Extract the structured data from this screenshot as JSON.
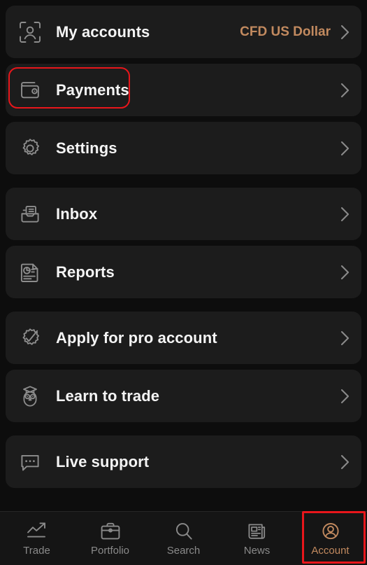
{
  "theme": {
    "page_bg": "#0d0d0d",
    "card_bg": "#1c1c1c",
    "accent": "#c28a5f",
    "highlight": "#e8161b",
    "label_color": "#f4f4f4",
    "icon_color": "#8d8d8d"
  },
  "menu": {
    "groups": [
      {
        "rows": [
          {
            "id": "my-accounts",
            "label": "My accounts",
            "value": "CFD US Dollar",
            "icon": "account-frame-icon",
            "chevron": true
          },
          {
            "id": "payments",
            "label": "Payments",
            "value": "",
            "icon": "wallet-icon",
            "chevron": true,
            "highlighted": true
          },
          {
            "id": "settings",
            "label": "Settings",
            "value": "",
            "icon": "gear-icon",
            "chevron": true
          }
        ]
      },
      {
        "rows": [
          {
            "id": "inbox",
            "label": "Inbox",
            "value": "",
            "icon": "inbox-tray-icon",
            "chevron": true
          },
          {
            "id": "reports",
            "label": "Reports",
            "value": "",
            "icon": "report-document-icon",
            "chevron": true
          }
        ]
      },
      {
        "rows": [
          {
            "id": "apply-pro-account",
            "label": "Apply for pro account",
            "value": "",
            "icon": "badge-check-icon",
            "chevron": true
          },
          {
            "id": "learn-to-trade",
            "label": "Learn to trade",
            "value": "",
            "icon": "owl-graduate-icon",
            "chevron": true
          }
        ]
      },
      {
        "rows": [
          {
            "id": "live-support",
            "label": "Live support",
            "value": "",
            "icon": "chat-bubble-icon",
            "chevron": true
          }
        ]
      }
    ]
  },
  "tabbar": {
    "tabs": [
      {
        "id": "trade",
        "label": "Trade",
        "icon": "trending-up-icon",
        "active": false
      },
      {
        "id": "portfolio",
        "label": "Portfolio",
        "icon": "briefcase-icon",
        "active": false
      },
      {
        "id": "search",
        "label": "Search",
        "icon": "magnifier-icon",
        "active": false
      },
      {
        "id": "news",
        "label": "News",
        "icon": "newspaper-icon",
        "active": false
      },
      {
        "id": "account",
        "label": "Account",
        "icon": "person-circle-icon",
        "active": true
      }
    ]
  }
}
